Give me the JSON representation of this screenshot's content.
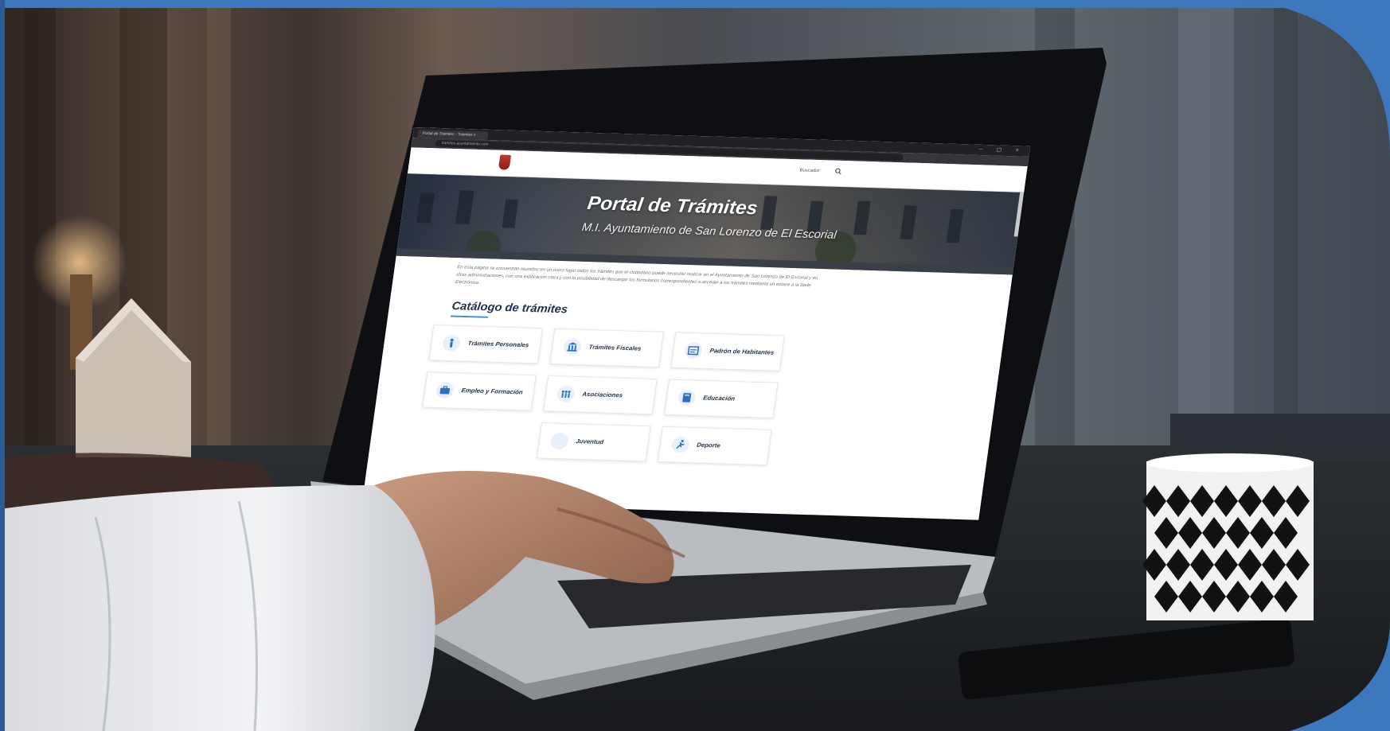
{
  "browser": {
    "tab_title": "Portal de Trámites - Tramites x",
    "url": "tramites.ayuntamiento.com"
  },
  "site": {
    "header_link": "Buscador",
    "hero_title": "Portal de Trámites",
    "hero_subtitle": "M.I. Ayuntamiento de San Lorenzo de El Escorial",
    "intro": "En esta página se encuentran reunidos en un único lugar todos los trámites que el ciudadano puede necesitar realizar en el Ayuntamiento de San Lorenzo de El Escorial y en otras administraciones, con una explicación clara y con la posibilidad de descargar los formularios correspondientes o acceder a los trámites mediante un enlace a la Sede Electrónica.",
    "catalog_title": "Catálogo de trámites",
    "cards": [
      {
        "label": "Trámites Personales",
        "icon": "person-icon"
      },
      {
        "label": "Trámites Fiscales",
        "icon": "bank-icon"
      },
      {
        "label": "Padrón de Habitantes",
        "icon": "register-icon"
      },
      {
        "label": "Empleo y Formación",
        "icon": "briefcase-icon"
      },
      {
        "label": "Asociaciones",
        "icon": "group-icon"
      },
      {
        "label": "Educación",
        "icon": "book-icon"
      },
      {
        "label": "Juventud",
        "icon": "youth-icon"
      },
      {
        "label": "Deporte",
        "icon": "runner-icon"
      }
    ]
  },
  "colors": {
    "accent": "#3a8bd8",
    "title_text": "#1f2f4d",
    "frame_blue": "#3b78bd"
  }
}
